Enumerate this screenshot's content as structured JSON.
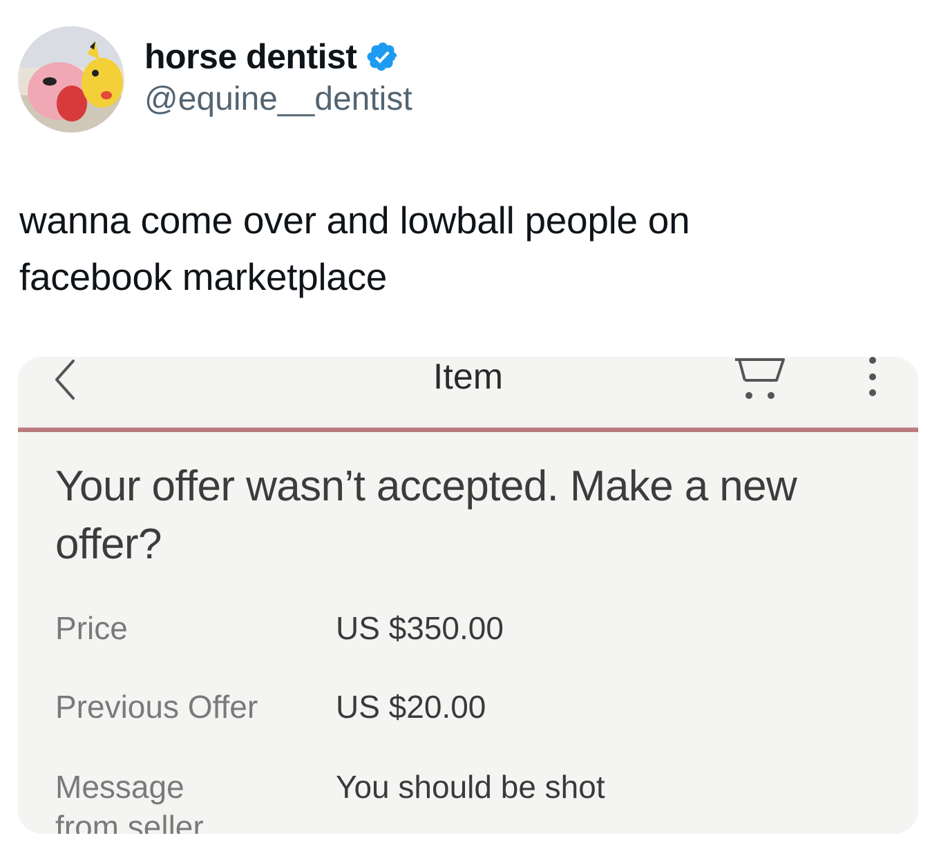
{
  "tweet": {
    "author": {
      "display_name": "horse dentist",
      "handle": "@equine__dentist",
      "verified": true,
      "verified_badge_color": "#1d9bf0"
    },
    "text": "wanna come over and lowball people on facebook marketplace"
  },
  "screenshot": {
    "topbar": {
      "title": "Item",
      "back_icon": "chevron-left-icon",
      "cart_icon": "cart-icon",
      "more_icon": "more-vertical-icon"
    },
    "accent_divider_color": "#b97a7d",
    "heading": "Your offer wasn’t accepted. Make a new offer?",
    "details": [
      {
        "label": "Price",
        "value": "US $350.00"
      },
      {
        "label": "Previous Offer",
        "value": "US $20.00"
      },
      {
        "label": "Message from seller",
        "value": "You should be shot"
      }
    ]
  }
}
